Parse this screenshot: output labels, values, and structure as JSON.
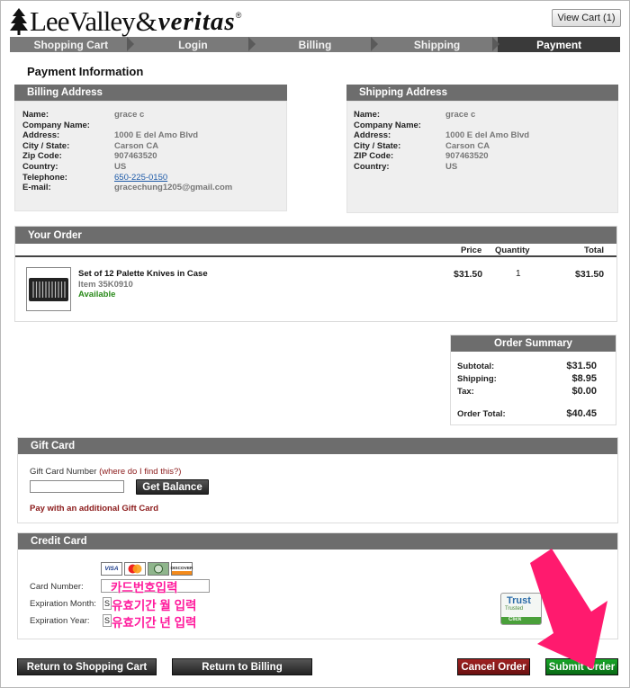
{
  "header": {
    "brand_main": "LeeValley",
    "brand_amp": "&",
    "brand_second": "veritas",
    "brand_reg": "®",
    "view_cart": "View Cart (1)"
  },
  "steps": [
    "Shopping Cart",
    "Login",
    "Billing",
    "Shipping",
    "Payment"
  ],
  "page_title": "Payment Information",
  "billing": {
    "title": "Billing Address",
    "rows": [
      {
        "k": "Name:",
        "v": "grace c"
      },
      {
        "k": "Company Name:",
        "v": ""
      },
      {
        "k": "Address:",
        "v": "1000 E del Amo Blvd"
      },
      {
        "k": "City / State:",
        "v": "Carson CA"
      },
      {
        "k": "Zip Code:",
        "v": "907463520"
      },
      {
        "k": "Country:",
        "v": "US"
      },
      {
        "k": "Telephone:",
        "v": "650-225-0150"
      },
      {
        "k": "E-mail:",
        "v": "gracechung1205@gmail.com"
      }
    ]
  },
  "shipping": {
    "title": "Shipping Address",
    "rows": [
      {
        "k": "Name:",
        "v": "grace c"
      },
      {
        "k": "Company Name:",
        "v": ""
      },
      {
        "k": "Address:",
        "v": "1000 E del Amo Blvd"
      },
      {
        "k": "City / State:",
        "v": "Carson CA"
      },
      {
        "k": "ZIP Code:",
        "v": "907463520"
      },
      {
        "k": "Country:",
        "v": "US"
      }
    ]
  },
  "order": {
    "title": "Your Order",
    "col_price": "Price",
    "col_qty": "Quantity",
    "col_total": "Total",
    "item": {
      "name": "Set of 12 Palette Knives in Case",
      "sku": "Item 35K0910",
      "status": "Available",
      "price": "$31.50",
      "qty": "1",
      "total": "$31.50"
    }
  },
  "summary": {
    "title": "Order Summary",
    "subtotal_label": "Subtotal:",
    "subtotal": "$31.50",
    "shipping_label": "Shipping:",
    "shipping": "$8.95",
    "tax_label": "Tax:",
    "tax": "$0.00",
    "total_label": "Order Total:",
    "total": "$40.45"
  },
  "giftcard": {
    "title": "Gift Card",
    "number_label": "Gift Card Number",
    "help_link": "(where do I find this?)",
    "get_balance": "Get Balance",
    "additional": "Pay with an additional Gift Card"
  },
  "credit": {
    "title": "Credit Card",
    "card_number_label": "Card Number:",
    "exp_month_label": "Expiration Month:",
    "exp_year_label": "Expiration Year:",
    "card_number_note": "카드번호입력",
    "exp_month_note": "유효기간 월 입력",
    "exp_year_note": "유효기간 년 입력",
    "select_stub": "S",
    "cards": [
      "VISA",
      "MC",
      "AMEX",
      "DISCOVER"
    ],
    "trust_text": "Trust",
    "trust_sub1": "Trusted",
    "trust_sub2": "Click"
  },
  "actions": {
    "return_cart": "Return to Shopping Cart",
    "return_billing": "Return to Billing",
    "cancel": "Cancel Order",
    "submit": "Submit Order"
  },
  "colors": {
    "submit_green": "#0a8a1a",
    "cancel_red": "#8b1a1a",
    "annotation_arrow": "#ff1a6e",
    "annotation_text": "#ff1a9c"
  }
}
